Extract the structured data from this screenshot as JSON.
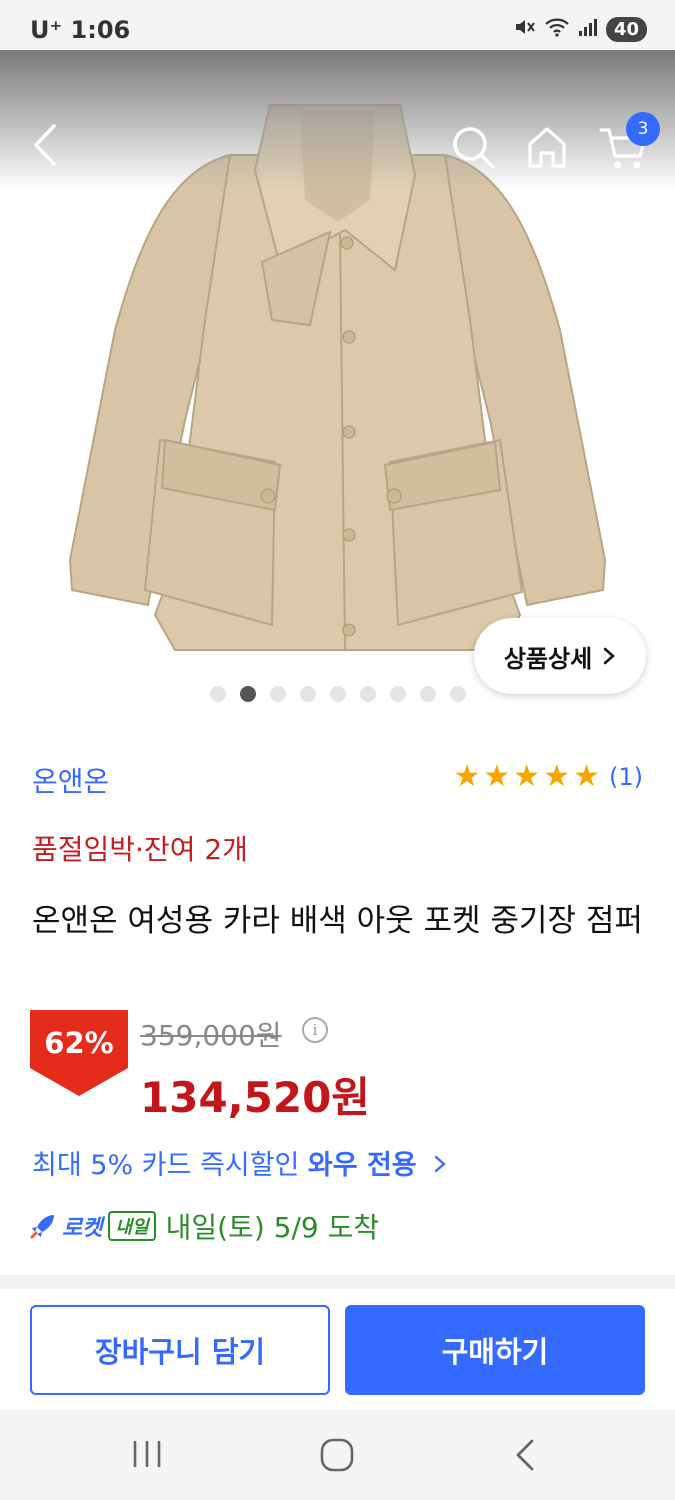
{
  "status_bar": {
    "carrier": "U⁺",
    "time": "1:06",
    "battery": "40"
  },
  "header": {
    "cart_count": "3"
  },
  "gallery": {
    "detail_button": "상품상세",
    "dot_count": 9,
    "active_dot": 1
  },
  "product": {
    "brand": "온앤온",
    "rating": 5,
    "review_count": "(1)",
    "stock_notice": "품절임박·잔여 2개",
    "title": "온앤온 여성용 카라 배색 아웃 포켓 중기장 점퍼",
    "discount": "62%",
    "original_price": "359,000원",
    "price": "134,520원",
    "card_promo_prefix": "최대 5% 카드 즉시할인 ",
    "card_promo_bold": "와우 전용",
    "rocket_word": "로켓",
    "rocket_tag": "내일",
    "delivery": "내일(토) 5/9 도착"
  },
  "actions": {
    "add_to_cart": "장바구니 담기",
    "buy_now": "구매하기"
  },
  "colors": {
    "accent": "#346aff",
    "sale_red": "#c2161b",
    "stock_red": "#c21e1e",
    "star": "#f7a600",
    "delivery_green": "#2a8c2a"
  }
}
